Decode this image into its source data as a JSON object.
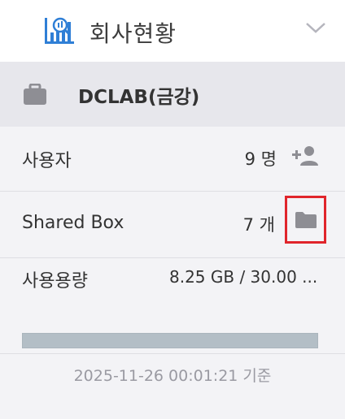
{
  "header": {
    "title": "회사현황",
    "logo_icon": "chart-search-icon",
    "toggle_icon": "chevron-down-icon"
  },
  "company": {
    "name": "DCLAB(금강)",
    "icon": "briefcase-icon"
  },
  "stats": {
    "users": {
      "label": "사용자",
      "value": "9 명",
      "action_icon": "add-user-icon"
    },
    "shared_box": {
      "label": "Shared Box",
      "value": "7 개",
      "action_icon": "folder-icon",
      "highlight_color": "#e0252b"
    },
    "usage": {
      "label": "사용용량",
      "value": "8.25 GB / 30.00 ...",
      "used_gb": 8.25,
      "total_gb": 30.0
    }
  },
  "footer": {
    "timestamp": "2025-11-26 00:01:21 기준"
  },
  "colors": {
    "accent": "#2f7fd6",
    "panel": "#f3f3f6",
    "company_bg": "#e7e7ec",
    "bar": "#b3bec6"
  }
}
